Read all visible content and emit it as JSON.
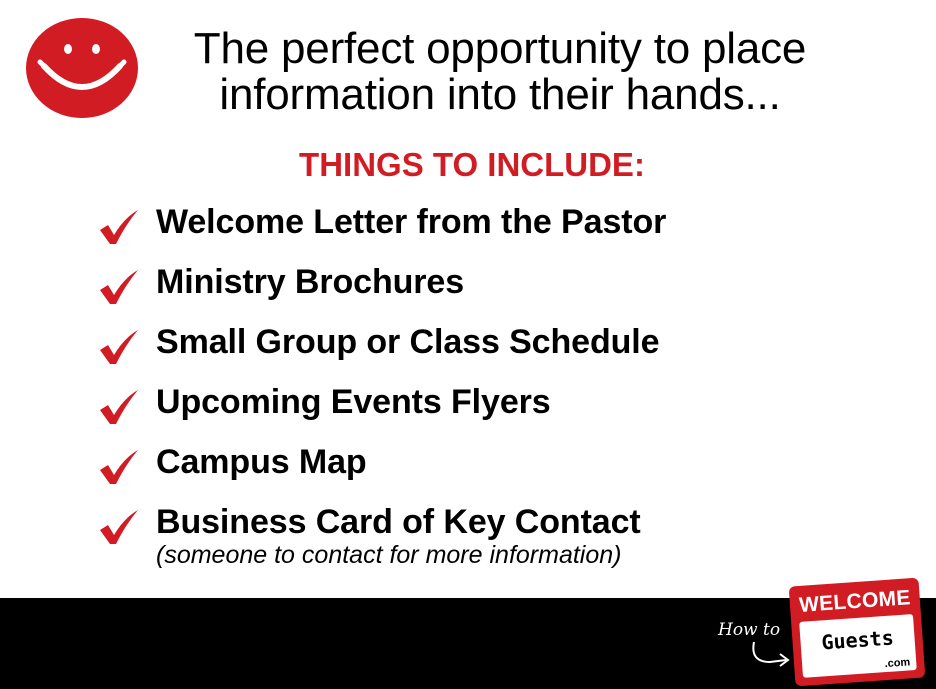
{
  "header": {
    "headline_line1": "The perfect opportunity to place",
    "headline_line2": "information into their hands...",
    "subhead": "THINGS TO INCLUDE:"
  },
  "checklist": {
    "items": [
      {
        "label": "Welcome Letter from the Pastor"
      },
      {
        "label": "Ministry Brochures"
      },
      {
        "label": "Small Group or Class Schedule"
      },
      {
        "label": "Upcoming Events Flyers"
      },
      {
        "label": "Campus Map"
      },
      {
        "label": "Business Card of Key Contact",
        "note": "(someone to contact for more information)"
      }
    ]
  },
  "logo": {
    "prefix": "How to",
    "title": "WELCOME",
    "name": "Guests",
    "suffix": ".com"
  },
  "colors": {
    "accent_red": "#d21c24",
    "text": "#000000",
    "background": "#ffffff",
    "footer": "#000000"
  },
  "icons": {
    "smiley": "smiley-face-icon",
    "check": "checkmark-icon",
    "arrow": "curved-arrow-icon"
  }
}
